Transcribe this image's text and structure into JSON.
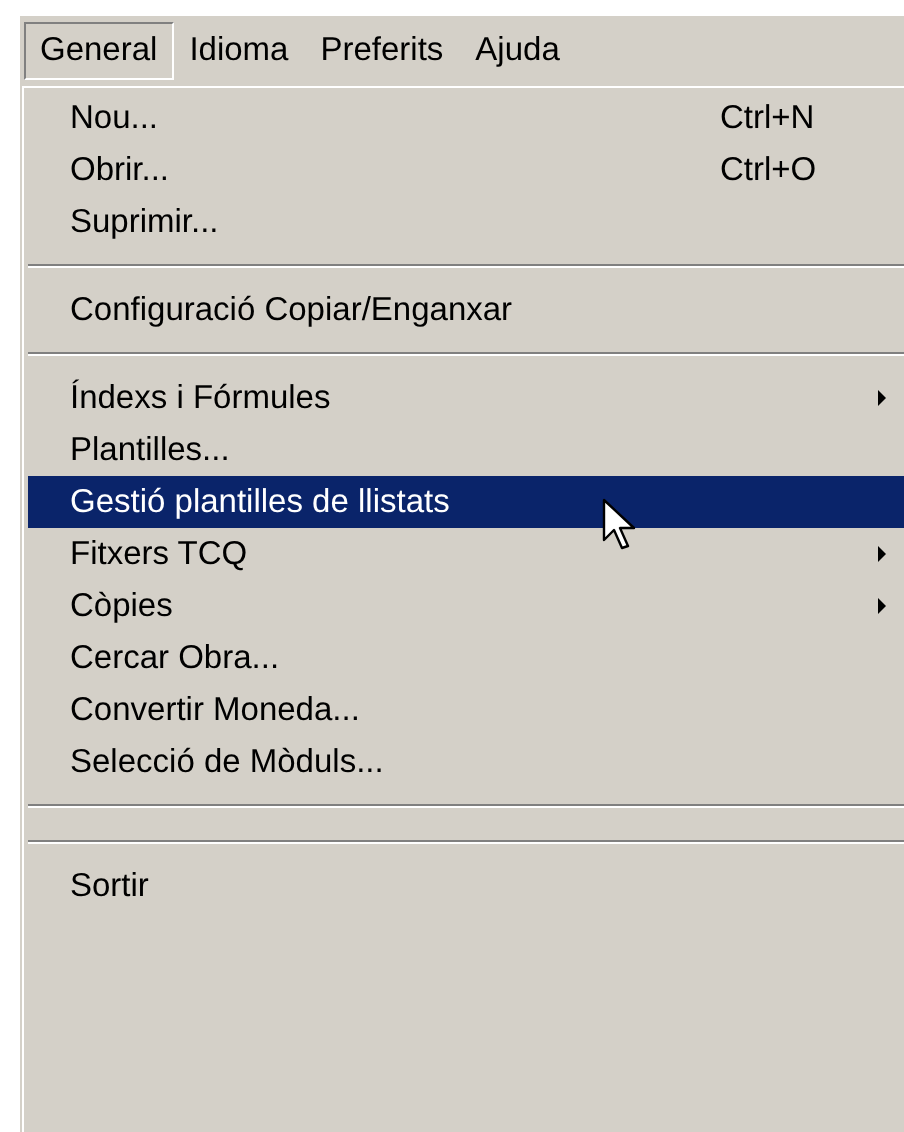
{
  "menu_bar": [
    {
      "label": "General",
      "selected": true
    },
    {
      "label": "Idioma",
      "selected": false
    },
    {
      "label": "Preferits",
      "selected": false
    },
    {
      "label": "Ajuda",
      "selected": false
    }
  ],
  "menu": {
    "items": [
      {
        "kind": "item",
        "label": "Nou...",
        "shortcut": "Ctrl+N",
        "submenu": false,
        "selected": false
      },
      {
        "kind": "item",
        "label": "Obrir...",
        "shortcut": "Ctrl+O",
        "submenu": false,
        "selected": false
      },
      {
        "kind": "item",
        "label": "Suprimir...",
        "submenu": false,
        "selected": false
      },
      {
        "kind": "separator"
      },
      {
        "kind": "item",
        "label": "Configuració Copiar/Enganxar",
        "submenu": false,
        "selected": false
      },
      {
        "kind": "separator"
      },
      {
        "kind": "item",
        "label": "Índexs i Fórmules",
        "submenu": true,
        "selected": false
      },
      {
        "kind": "item",
        "label": "Plantilles...",
        "submenu": false,
        "selected": false
      },
      {
        "kind": "item",
        "label": "Gestió plantilles de llistats",
        "submenu": false,
        "selected": true
      },
      {
        "kind": "item",
        "label": "Fitxers TCQ",
        "submenu": true,
        "selected": false
      },
      {
        "kind": "item",
        "label": "Còpies",
        "submenu": true,
        "selected": false
      },
      {
        "kind": "item",
        "label": "Cercar Obra...",
        "submenu": false,
        "selected": false
      },
      {
        "kind": "item",
        "label": "Convertir Moneda...",
        "submenu": false,
        "selected": false
      },
      {
        "kind": "item",
        "label": "Selecció de Mòduls...",
        "submenu": false,
        "selected": false
      },
      {
        "kind": "separator"
      },
      {
        "kind": "separator"
      },
      {
        "kind": "item",
        "label": "Sortir",
        "submenu": false,
        "selected": false
      }
    ]
  }
}
